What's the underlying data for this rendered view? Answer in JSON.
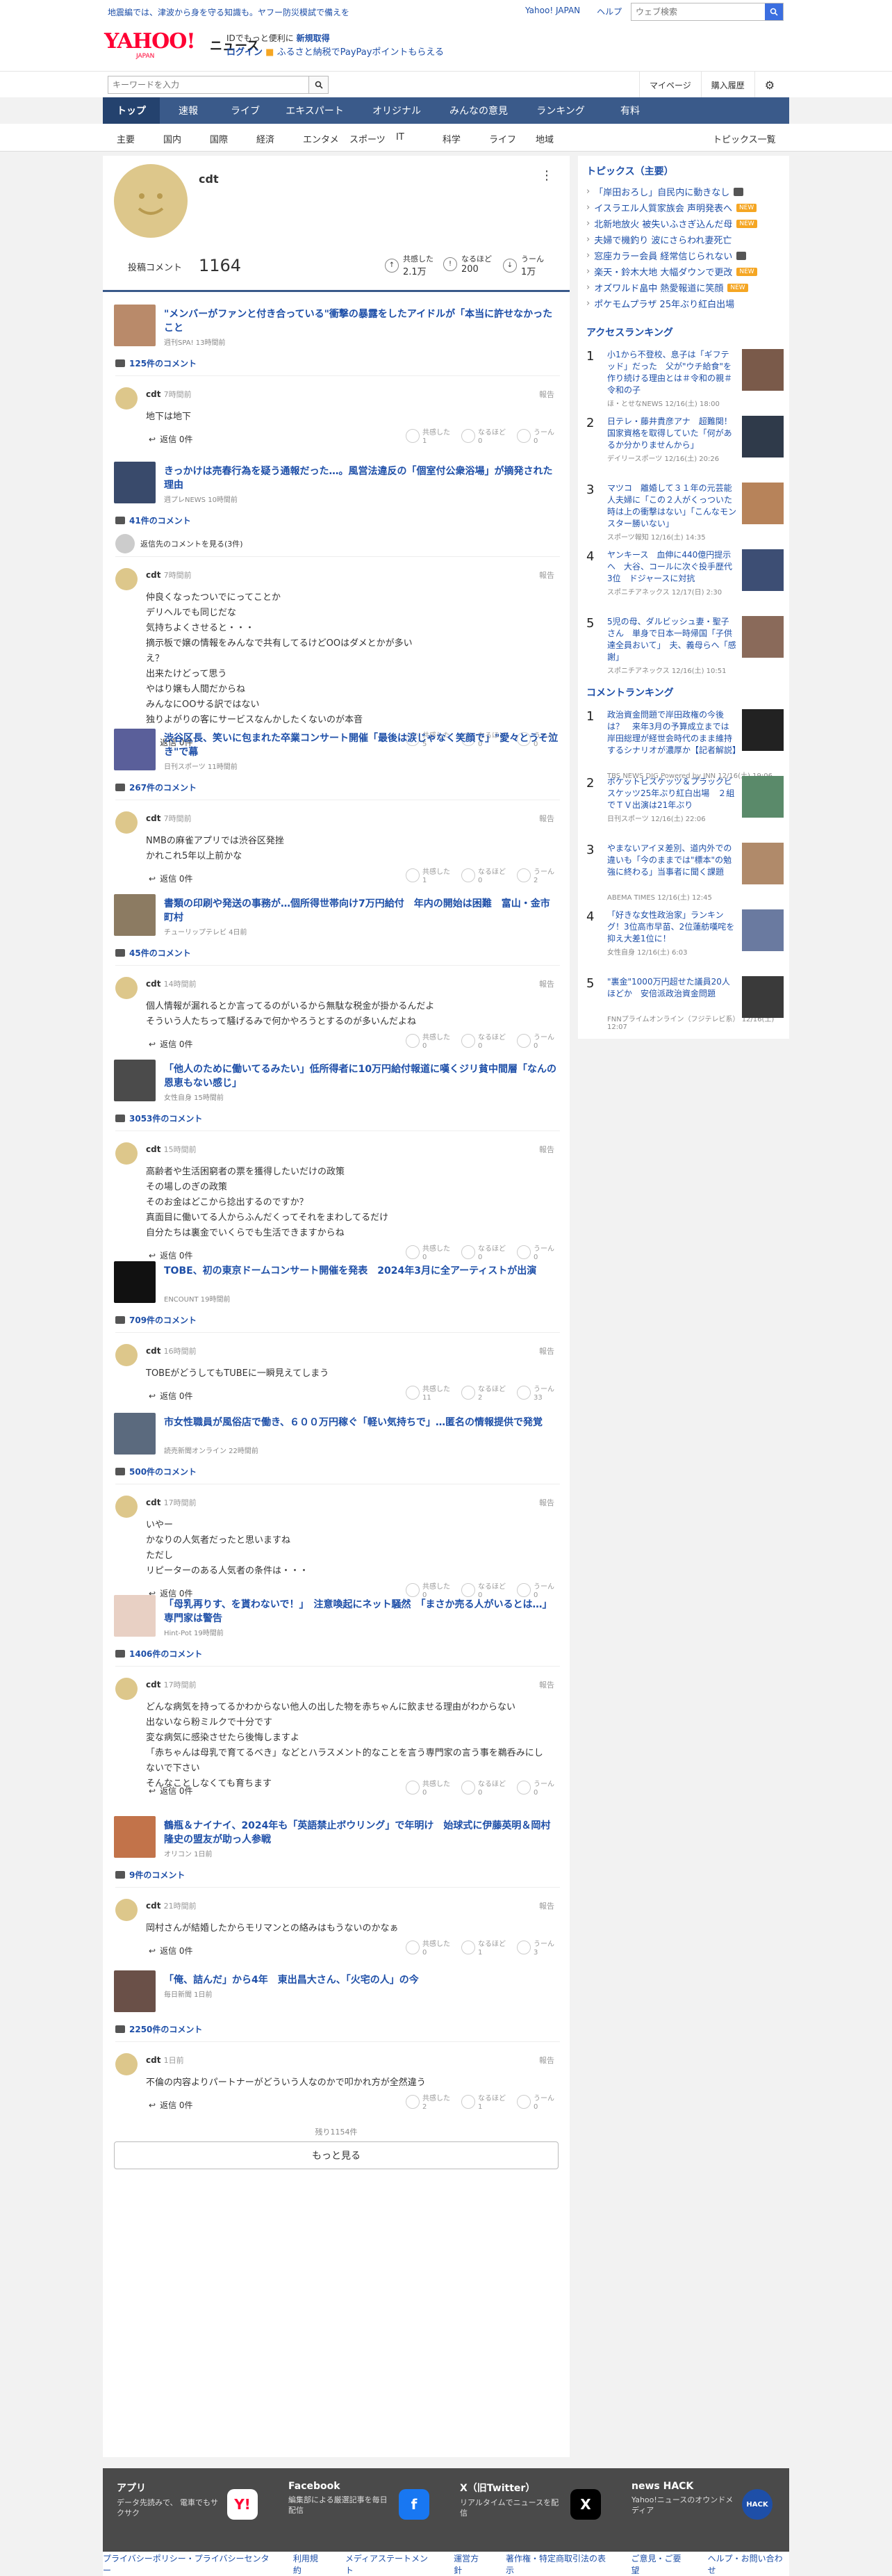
{
  "topbar": {
    "notice": "地震編では、津波から身を守る知識も。ヤフー防災模試で備えを",
    "links": [
      "Yahoo! JAPAN",
      "ヘルプ"
    ],
    "search_placeholder": "ウェブ検索"
  },
  "header": {
    "logo": "YAHOO!",
    "logo_sub": "JAPAN",
    "service": "ニュース",
    "promo_line1_prefix": "IDでもっと便利に",
    "promo_line1_link": "新規取得",
    "promo_login": "ログイン",
    "promo_line2": "ふるさと納税でPayPayポイントもらえる",
    "kw_placeholder": "キーワードを入力",
    "mypage": "マイページ",
    "history": "購入履歴"
  },
  "nav": {
    "tabs": [
      "トップ",
      "速報",
      "ライブ",
      "エキスパート",
      "オリジナル",
      "みんなの意見",
      "ランキング",
      "有料"
    ],
    "sub": [
      "主要",
      "国内",
      "国際",
      "経済",
      "エンタメ",
      "スポーツ",
      "IT",
      "科学",
      "ライフ",
      "地域"
    ],
    "topics_list": "トピックス一覧"
  },
  "profile": {
    "name": "cdt",
    "comments_label": "投稿コメント",
    "comments_count": "1164",
    "r1_label": "共感した",
    "r1_value": "2.1万",
    "r2_label": "なるほど",
    "r2_value": "200",
    "r3_label": "うーん",
    "r3_value": "1万"
  },
  "entries": [
    {
      "title": "\"メンバーがファンと付き合っている\"衝撃の暴露をしたアイドルが「本当に許せなかったこと",
      "source": "週刊SPA! 13時間前",
      "count": "125件のコメント",
      "time": "7時間前",
      "text": "地下は地下",
      "reply": "返信 0件",
      "r": [
        "1",
        "0",
        "0"
      ]
    },
    {
      "title": "きっかけは売春行為を疑う通報だった…。風営法違反の「個室付公衆浴場」が摘発された理由",
      "source": "週プレNEWS 10時間前",
      "count": "41件のコメント",
      "time": "7時間前",
      "text": "仲良くなったついでにってことか\nデリヘルでも同じだな\n気持ちよくさせると・・・\n摘示板で嬢の情報をみんなで共有してるけどOOはダメとかが多い\nえ？\n出来たけどって思う\nやはり嬢も人間だからね\nみんなにOOサる訳ではない\n独りよがりの客にサービスなんかしたくないのが本音",
      "reply": "返信 0件",
      "r": [
        "5",
        "0",
        "0"
      ],
      "prev": "返信先のコメントを見る(3件)"
    },
    {
      "title": "渋谷区長、笑いに包まれた卒業コンサート開催「最後は涙じゃなく笑顔で」\"愛々とうそ泣き\"で幕",
      "source": "日刊スポーツ 11時間前",
      "count": "267件のコメント",
      "time": "7時間前",
      "text": "NMBの麻雀アプリでは渋谷区発挫\nかれこれ5年以上前かな",
      "reply": "返信 0件",
      "r": [
        "1",
        "0",
        "2"
      ]
    },
    {
      "title": "書類の印刷や発送の事務が…個所得世帯向け7万円給付　年内の開始は困難　富山・金市町村",
      "source": "チューリップテレビ 4日前",
      "count": "45件のコメント",
      "time": "14時間前",
      "text": "個人情報が漏れるとか言ってるのがいるから無駄な税金が掛かるんだよ\nそういう人たちって騒げるみで何かやろうとするのが多いんだよね",
      "reply": "返信 0件",
      "r": [
        "0",
        "0",
        "0"
      ]
    },
    {
      "title": "「他人のために働いてるみたい」低所得者に10万円給付報道に嘆くジリ貧中間層「なんの恩恵もない感じ」",
      "source": "女性自身 15時間前",
      "count": "3053件のコメント",
      "time": "15時間前",
      "text": "高齢者や生活困窮者の票を獲得したいだけの政策\nその場しのぎの政策\nそのお金はどこから捻出するのですか？\n真面目に働いてる人からふんだくってそれをまわしてるだけ\n自分たちは裏金でいくらでも生活できますからね",
      "reply": "返信 0件",
      "r": [
        "0",
        "0",
        "0"
      ]
    },
    {
      "title": "TOBE、初の東京ドームコンサート開催を発表　2024年3月に全アーティストが出演",
      "source": "ENCOUNT 19時間前",
      "count": "709件のコメント",
      "time": "16時間前",
      "text": "TOBEがどうしてもTUBEに一瞬見えてしまう",
      "reply": "返信 0件",
      "r": [
        "11",
        "2",
        "33"
      ]
    },
    {
      "title": "市女性職員が風俗店で働き、６００万円稼ぐ「軽い気持ちで」…匿名の情報提供で発覚",
      "source": "読売新聞オンライン 22時間前",
      "count": "500件のコメント",
      "time": "17時間前",
      "text": "いやー\nかなりの人気者だったと思いますね\nただし\nリピーターのある人気者の条件は・・・",
      "reply": "返信 0件",
      "r": [
        "0",
        "0",
        "0"
      ]
    },
    {
      "title": "「母乳再りす、を貰わないで！」　注意喚起にネット騒然　「まさか売る人がいるとは…」　専門家は警告",
      "source": "Hint-Pot 19時間前",
      "count": "1406件のコメント",
      "time": "17時間前",
      "text": "どんな病気を持ってるかわからない他人の出した物を赤ちゃんに飲ませる理由がわからない\n出ないなら粉ミルクで十分です\n変な病気に感染させたら後悔しますよ\n「赤ちゃんは母乳で育てるべき」などとハラスメント的なことを言う専門家の言う事を鵜呑みにしないで下さい\nそんなことしなくても育ちます",
      "reply": "返信 0件",
      "r": [
        "0",
        "0",
        "0"
      ]
    },
    {
      "title": "鶴瓶＆ナイナイ、2024年も「英語禁止ボウリング」で年明け　始球式に伊藤英明＆岡村隆史の盟友が助っ人参戦",
      "source": "オリコン 1日前",
      "count": "9件のコメント",
      "time": "21時間前",
      "text": "岡村さんが結婚したからモリマンとの絡みはもうないのかなぁ",
      "reply": "返信 0件",
      "r": [
        "0",
        "1",
        "3"
      ]
    },
    {
      "title": "「俺、詰んだ」から4年　東出昌大さん、「火宅の人」の今",
      "source": "毎日新聞 1日前",
      "count": "2250件のコメント",
      "time": "1日前",
      "text": "不倫の内容よりパートナーがどういう人なのかで叩かれ方が全然違う",
      "reply": "返信 0件",
      "r": [
        "2",
        "1",
        "0"
      ]
    }
  ],
  "remaining": "残り1154件",
  "more_button": "もっと見る",
  "sidebar": {
    "topics_title": "トピックス（主要）",
    "topics": [
      {
        "text": "「岸田おろし」自民内に動きなし",
        "badge": "photo"
      },
      {
        "text": "イスラエル人質家族会 声明発表へ",
        "badge": "NEW"
      },
      {
        "text": "北新地放火 被失いふさぎ込んだ母",
        "badge": "NEW"
      },
      {
        "text": "夫婦で機釣り 波にさらわれ妻死亡",
        "badge": ""
      },
      {
        "text": "窓座カラー会員 経常信じられない",
        "badge": "photo"
      },
      {
        "text": "楽天・鈴木大地 大幅ダウンで更改",
        "badge": "NEW"
      },
      {
        "text": "オズワルド畠中 熱愛報道に笑顔",
        "badge": "NEW"
      },
      {
        "text": "ポケモムプラザ 25年ぶり紅白出場",
        "badge": ""
      }
    ],
    "access_title": "アクセスランキング",
    "access": [
      {
        "n": "1",
        "t": "小1から不登校、息子は「ギフテッド」だった　父が\"ウチ給食\"を作り続ける理由とは＃令和の親＃令和の子",
        "s": "ほ・とせなNEWS 12/16(土) 18:00"
      },
      {
        "n": "2",
        "t": "日テレ・藤井貴彦アナ　超難関！国家資格を取得していた「何があるか分かりませんから」",
        "s": "デイリースポーツ 12/16(土) 20:26"
      },
      {
        "n": "3",
        "t": "マツコ　離婚して３１年の元芸能人夫婦に「この２人がくっついた時は上の衝撃はない」「こんなモンスター勝いない」",
        "s": "スポーツ報知 12/16(土) 14:35"
      },
      {
        "n": "4",
        "t": "ヤンキース　血伸に440億円提示へ　大谷、コールに次ぐ投手歴代3位　ドジャースに対抗",
        "s": "スポニチアネックス 12/17(日) 2:30"
      },
      {
        "n": "5",
        "t": "5児の母、ダルビッシュ妻・聖子さん　単身で日本一時帰国「子供達全員おいて」　夫、義母らへ「感謝」",
        "s": "スポニチアネックス 12/16(土) 10:51"
      }
    ],
    "comment_title": "コメントランキング",
    "comments": [
      {
        "n": "1",
        "t": "政治資金問題で岸田政権の今後は？　来年3月の予算成立までは岸田総理が経世会時代のまま維持するシナリオが濃厚か【記者解説】",
        "s": "TBS NEWS DIG Powered by JNN 12/16(土) 19:06"
      },
      {
        "n": "2",
        "t": "ボケットビスケッツ＆ブラックビスケッツ25年ぶり紅白出場　２組でＴＶ出演は21年ぶり",
        "s": "日刊スポーツ 12/16(土) 22:06"
      },
      {
        "n": "3",
        "t": "やまないアイヌ差別、道内外での違いも「今のままでは\"標本\"の勉強に終わる」当事者に聞く課題",
        "s": "ABEMA TIMES 12/16(土) 12:45"
      },
      {
        "n": "4",
        "t": "「好きな女性政治家」ランキング！3位高市早苗、2位蓮舫嘆咤を抑え大差1位に！",
        "s": "女性自身 12/16(土) 6:03"
      },
      {
        "n": "5",
        "t": "\"裏金\"1000万円超せた議員20人ほどか　安倍派政治資金問題",
        "s": "FNNプライムオンライン（フジテレビ系） 12/16(土) 12:07"
      }
    ]
  },
  "apps": [
    {
      "name": "アプリ",
      "desc": "データ先読みで、 電車でもサクサク",
      "icon": "Y!"
    },
    {
      "name": "Facebook",
      "desc": "編集部による厳選記事を毎日配信",
      "icon": "f"
    },
    {
      "name": "X（旧Twitter）",
      "desc": "リアルタイムでニュースを配信",
      "icon": "X"
    },
    {
      "name": "news HACK",
      "desc": "Yahoo!ニュースのオウンドメディア",
      "icon": "HACK"
    }
  ],
  "footer": [
    "プライバシーポリシー・プライバシーセンター",
    "利用規約",
    "メディアステートメント",
    "運営方針",
    "著作権・特定商取引法の表示",
    "ご意見・ご要望",
    "ヘルプ・お問い合わせ"
  ],
  "reactions": [
    "共感した",
    "なるほど",
    "うーん"
  ],
  "report_label": "報告",
  "colors": {
    "accent": "#1e4fa8",
    "nav": "#3a5a8a",
    "brand": "#ff0033"
  }
}
